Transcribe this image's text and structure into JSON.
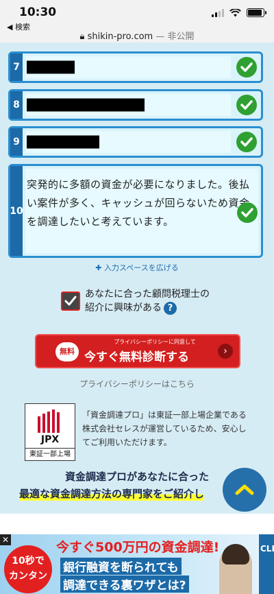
{
  "status": {
    "time": "10:30",
    "back_label": "◀ 検索",
    "domain": "shikin-pro.com",
    "suffix": " — 非公開"
  },
  "form": {
    "rows": [
      {
        "number": "7"
      },
      {
        "number": "8"
      },
      {
        "number": "9"
      },
      {
        "number": "10",
        "text": "突発的に多額の資金が必要になりました。後払い案件が多く、キャッシュが回らないため資金を調達したいと考えています。"
      }
    ],
    "expand_label": "入力スペースを広げる",
    "consent": {
      "line1": "あなたに合った顧問税理士の",
      "line2": "紹介に興味がある",
      "help": "?"
    },
    "cta": {
      "sub": "プライバシーポリシーに同意して",
      "badge": "無料",
      "label": "今すぐ無料診断する",
      "arrow": "›"
    },
    "privacy_link": "プライバシーポリシーはこちら"
  },
  "jpx": {
    "logo_text": "JPX",
    "caption": "東証一部上場",
    "description": "「資金調達プロ」は東証一部上場企業である株式会社セレスが運営しているため、安心してご利用いただけます。"
  },
  "promo": {
    "line1": "資金調達プロがあなたに合った",
    "line2": "最適な資金調達方法の専門家をご紹介し"
  },
  "ad": {
    "close": "✕",
    "circle_line1": "10秒で",
    "circle_line2": "カンタン",
    "headline": "今すぐ500万円の資金調達!",
    "line2": "銀行融資を断られても",
    "line3": "調達できる裏ワザとは?",
    "click": "CLICK"
  },
  "colors": {
    "accent": "#1c6aa8",
    "check_green": "#2fa032",
    "cta_red": "#d31f1f",
    "bg_light_blue": "#d6ecf5"
  }
}
